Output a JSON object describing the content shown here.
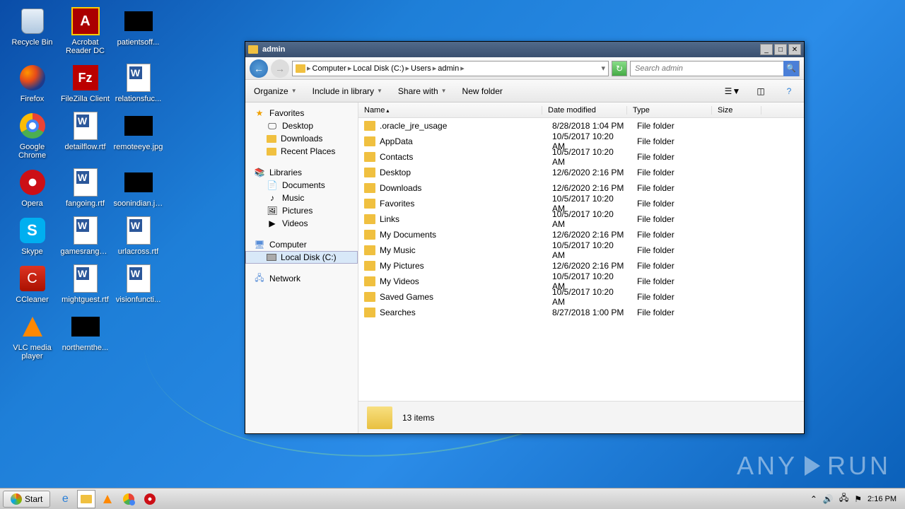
{
  "desktop_icons": [
    {
      "label": "Recycle Bin",
      "icon": "bin",
      "two": false
    },
    {
      "label": "Acrobat Reader DC",
      "icon": "adobe",
      "two": true
    },
    {
      "label": "patientsoff...",
      "icon": "black",
      "two": false
    },
    {
      "label": "Firefox",
      "icon": "firefox",
      "two": false
    },
    {
      "label": "FileZilla Client",
      "icon": "filezilla",
      "two": false
    },
    {
      "label": "relationsfuc...",
      "icon": "word",
      "two": false
    },
    {
      "label": "Google Chrome",
      "icon": "chrome",
      "two": true
    },
    {
      "label": "detailflow.rtf",
      "icon": "word",
      "two": false
    },
    {
      "label": "remoteeye.jpg",
      "icon": "black",
      "two": false
    },
    {
      "label": "Opera",
      "icon": "opera",
      "two": false
    },
    {
      "label": "fangoing.rtf",
      "icon": "word",
      "two": false
    },
    {
      "label": "soonindian.jpg",
      "icon": "black",
      "two": false
    },
    {
      "label": "Skype",
      "icon": "skype",
      "two": false
    },
    {
      "label": "gamesrange...",
      "icon": "word",
      "two": false
    },
    {
      "label": "urlacross.rtf",
      "icon": "word",
      "two": false
    },
    {
      "label": "CCleaner",
      "icon": "ccleaner",
      "two": false
    },
    {
      "label": "mightguest.rtf",
      "icon": "word",
      "two": false
    },
    {
      "label": "visionfuncti...",
      "icon": "word",
      "two": false
    },
    {
      "label": "VLC media player",
      "icon": "vlc",
      "two": true
    },
    {
      "label": "northernthe...",
      "icon": "black",
      "two": false
    }
  ],
  "explorer": {
    "title": "admin",
    "breadcrumbs": [
      "Computer",
      "Local Disk (C:)",
      "Users",
      "admin"
    ],
    "search_placeholder": "Search admin",
    "toolbar": {
      "organize": "Organize",
      "include": "Include in library",
      "share": "Share with",
      "newfolder": "New folder"
    },
    "nav": {
      "favorites": {
        "label": "Favorites",
        "items": [
          "Desktop",
          "Downloads",
          "Recent Places"
        ]
      },
      "libraries": {
        "label": "Libraries",
        "items": [
          "Documents",
          "Music",
          "Pictures",
          "Videos"
        ]
      },
      "computer": {
        "label": "Computer",
        "items": [
          "Local Disk (C:)"
        ]
      },
      "network": {
        "label": "Network"
      }
    },
    "columns": {
      "name": "Name",
      "date": "Date modified",
      "type": "Type",
      "size": "Size"
    },
    "files": [
      {
        "name": ".oracle_jre_usage",
        "date": "8/28/2018 1:04 PM",
        "type": "File folder"
      },
      {
        "name": "AppData",
        "date": "10/5/2017 10:20 AM",
        "type": "File folder"
      },
      {
        "name": "Contacts",
        "date": "10/5/2017 10:20 AM",
        "type": "File folder"
      },
      {
        "name": "Desktop",
        "date": "12/6/2020 2:16 PM",
        "type": "File folder"
      },
      {
        "name": "Downloads",
        "date": "12/6/2020 2:16 PM",
        "type": "File folder"
      },
      {
        "name": "Favorites",
        "date": "10/5/2017 10:20 AM",
        "type": "File folder"
      },
      {
        "name": "Links",
        "date": "10/5/2017 10:20 AM",
        "type": "File folder"
      },
      {
        "name": "My Documents",
        "date": "12/6/2020 2:16 PM",
        "type": "File folder"
      },
      {
        "name": "My Music",
        "date": "10/5/2017 10:20 AM",
        "type": "File folder"
      },
      {
        "name": "My Pictures",
        "date": "12/6/2020 2:16 PM",
        "type": "File folder"
      },
      {
        "name": "My Videos",
        "date": "10/5/2017 10:20 AM",
        "type": "File folder"
      },
      {
        "name": "Saved Games",
        "date": "10/5/2017 10:20 AM",
        "type": "File folder"
      },
      {
        "name": "Searches",
        "date": "8/27/2018 1:00 PM",
        "type": "File folder"
      }
    ],
    "details": "13 items"
  },
  "taskbar": {
    "start": "Start",
    "clock": "2:16 PM"
  },
  "watermark": "ANY      RUN"
}
